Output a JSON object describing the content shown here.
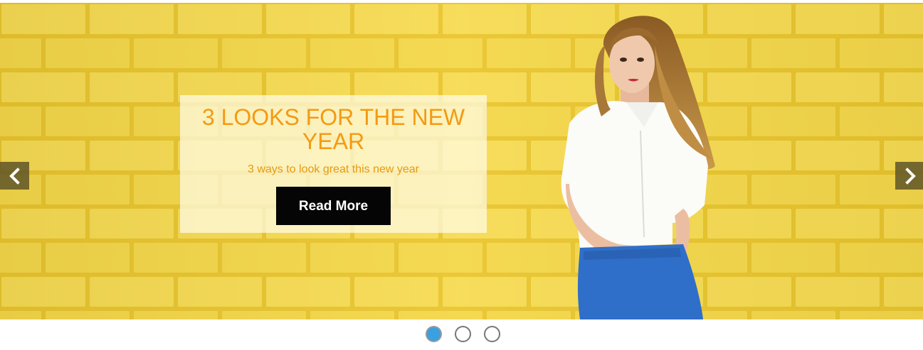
{
  "slider": {
    "active_index": 0,
    "slide": {
      "title": "3 LOOKS FOR THE NEW YEAR",
      "subtitle": "3 ways to look great this new year",
      "button_label": "Read More"
    },
    "prev_icon": "chevron-left-icon",
    "next_icon": "chevron-right-icon",
    "dots_count": 3
  },
  "colors": {
    "background_wall": "#f2d33f",
    "title": "#f39a12",
    "button_bg": "#050505",
    "dot_active": "#3aa0e2"
  }
}
